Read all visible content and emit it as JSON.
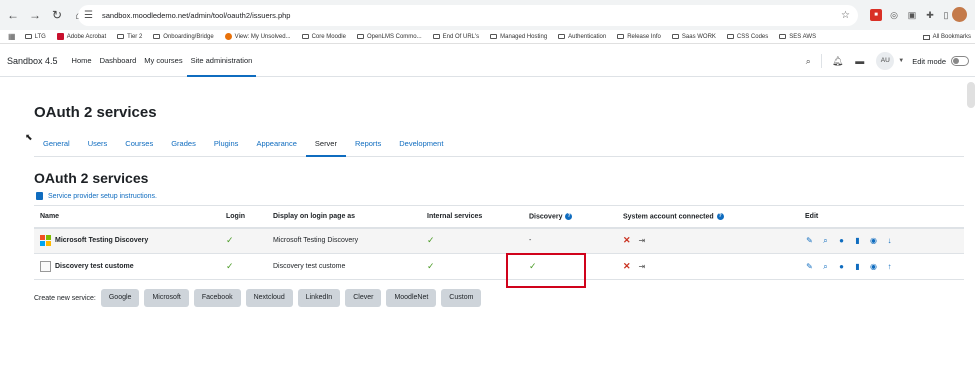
{
  "browser": {
    "url": "sandbox.moodledemo.net/admin/tool/oauth2/issuers.php",
    "bookmarks": [
      "LTG",
      "Adobe Acrobat",
      "Tier 2",
      "Onboarding/Bridge",
      "View: My Unsolved...",
      "Core Moodle",
      "OpenLMS Commo...",
      "End Of URL's",
      "Managed Hosting",
      "Authentication",
      "Release Info",
      "Saas WORK",
      "CSS Codes",
      "SES AWS"
    ],
    "all_bookmarks": "All Bookmarks"
  },
  "navbar": {
    "brand": "Sandbox 4.5",
    "links": [
      "Home",
      "Dashboard",
      "My courses",
      "Site administration"
    ],
    "avatar": "AU",
    "edit_mode": "Edit mode"
  },
  "page": {
    "title": "OAuth 2 services",
    "tabs": [
      "General",
      "Users",
      "Courses",
      "Grades",
      "Plugins",
      "Appearance",
      "Server",
      "Reports",
      "Development"
    ],
    "active_tab": "Server",
    "section_title": "OAuth 2 services",
    "instructions_link": "Service provider setup instructions."
  },
  "table": {
    "headers": [
      "Name",
      "Login",
      "Display on login page as",
      "Internal services",
      "Discovery",
      "System account connected",
      "Edit"
    ],
    "rows": [
      {
        "name": "Microsoft Testing Discovery",
        "login": "✓",
        "display": "Microsoft Testing Discovery",
        "internal": "✓",
        "discovery": "-",
        "system": "✕",
        "move": "↓"
      },
      {
        "name": "Discovery test custome",
        "login": "✓",
        "display": "Discovery test custome",
        "internal": "✓",
        "discovery": "✓",
        "system": "✕",
        "move": "↑"
      }
    ]
  },
  "create": {
    "label": "Create new service:",
    "buttons": [
      "Google",
      "Microsoft",
      "Facebook",
      "Nextcloud",
      "LinkedIn",
      "Clever",
      "MoodleNet",
      "Custom"
    ]
  },
  "colors": {
    "link": "#0f6cbf",
    "check": "#4a9b26",
    "cross": "#ca3120",
    "highlight": "#d0021b"
  },
  "icons": {
    "edit": "pencil-icon",
    "search": "search-icon",
    "user": "user-icon",
    "delete": "trash-icon",
    "view": "eye-icon"
  }
}
